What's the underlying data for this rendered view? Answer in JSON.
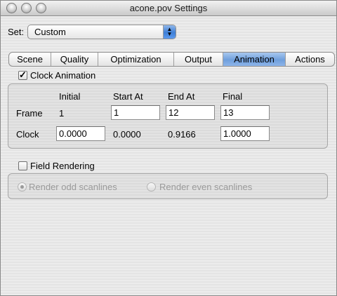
{
  "window": {
    "title": "acone.pov Settings"
  },
  "set": {
    "label": "Set:",
    "selected": "Custom"
  },
  "tabs": [
    {
      "label": "Scene"
    },
    {
      "label": "Quality"
    },
    {
      "label": "Optimization"
    },
    {
      "label": "Output"
    },
    {
      "label": "Animation"
    },
    {
      "label": "Actions"
    }
  ],
  "clock_animation": {
    "label": "Clock Animation",
    "checked": true,
    "headers": {
      "initial": "Initial",
      "start": "Start At",
      "end": "End At",
      "final": "Final"
    },
    "frame": {
      "label": "Frame",
      "initial": "1",
      "start": "1",
      "end": "12",
      "final": "13"
    },
    "clock": {
      "label": "Clock",
      "initial": "0.0000",
      "start": "0.0000",
      "end": "0.9166",
      "final": "1.0000"
    }
  },
  "field_rendering": {
    "label": "Field Rendering",
    "checked": false,
    "odd_label": "Render odd scanlines",
    "even_label": "Render even scanlines",
    "selected": "odd"
  }
}
